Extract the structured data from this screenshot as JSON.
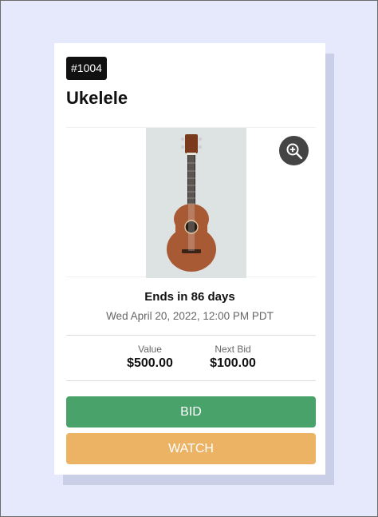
{
  "item": {
    "lot_number": "#1004",
    "title": "Ukelele",
    "ends_in": "Ends in 86 days",
    "end_datetime": "Wed April 20, 2022, 12:00 PM PDT"
  },
  "stats": {
    "value_label": "Value",
    "value_amount": "$500.00",
    "next_bid_label": "Next Bid",
    "next_bid_amount": "$100.00"
  },
  "actions": {
    "bid_label": "BID",
    "watch_label": "WATCH"
  },
  "icons": {
    "zoom": "zoom-in-icon"
  },
  "colors": {
    "bid_button": "#4aa26b",
    "watch_button": "#ecb365",
    "badge": "#111111",
    "page_background": "#e5e9fb"
  }
}
